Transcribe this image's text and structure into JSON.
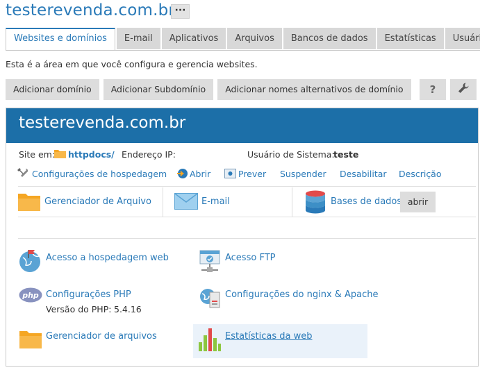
{
  "header": {
    "title": "testerevenda.com.br",
    "more_label": "···"
  },
  "tabs": [
    {
      "label": "Websites e domínios",
      "active": true
    },
    {
      "label": "E-mail"
    },
    {
      "label": "Aplicativos"
    },
    {
      "label": "Arquivos"
    },
    {
      "label": "Bancos de dados"
    },
    {
      "label": "Estatísticas"
    },
    {
      "label": "Usuários"
    }
  ],
  "description": "Esta é a área em que você configura e gerencia websites.",
  "actions": {
    "add_domain": "Adicionar domínio",
    "add_subdomain": "Adicionar Subdomínio",
    "add_aliases": "Adicionar nomes alternativos de domínio",
    "help": "?"
  },
  "domain": {
    "name": "testerevenda.com.br",
    "site_label": "Site em:",
    "site_folder": "httpdocs/",
    "ip_label": "Endereço IP:",
    "ip_value": "",
    "sys_user_label": "Usuário de Sistema:",
    "sys_user_value": "teste",
    "links": {
      "hosting": "Configurações de hospedagem",
      "open": "Abrir",
      "preview": "Prever",
      "suspend": "Suspender",
      "disable": "Desabilitar",
      "description": "Descrição"
    },
    "quick": {
      "file_manager": "Gerenciador de Arquivo",
      "email": "E-mail",
      "databases": "Bases de dados",
      "open_btn": "abrir"
    },
    "tools": {
      "web_hosting_access": "Acesso a hospedagem web",
      "ftp_access": "Acesso FTP",
      "php_settings": "Configurações PHP",
      "php_version_label": "Versão do PHP:",
      "php_version_value": "5.4.16",
      "nginx_apache": "Configurações do nginx & Apache",
      "file_manager2": "Gerenciador de arquivos",
      "web_stats": "Estatísticas da web"
    }
  },
  "colors": {
    "accent": "#2a7ab8",
    "header_bg": "#1c6fa8",
    "folder": "#f5a623"
  }
}
